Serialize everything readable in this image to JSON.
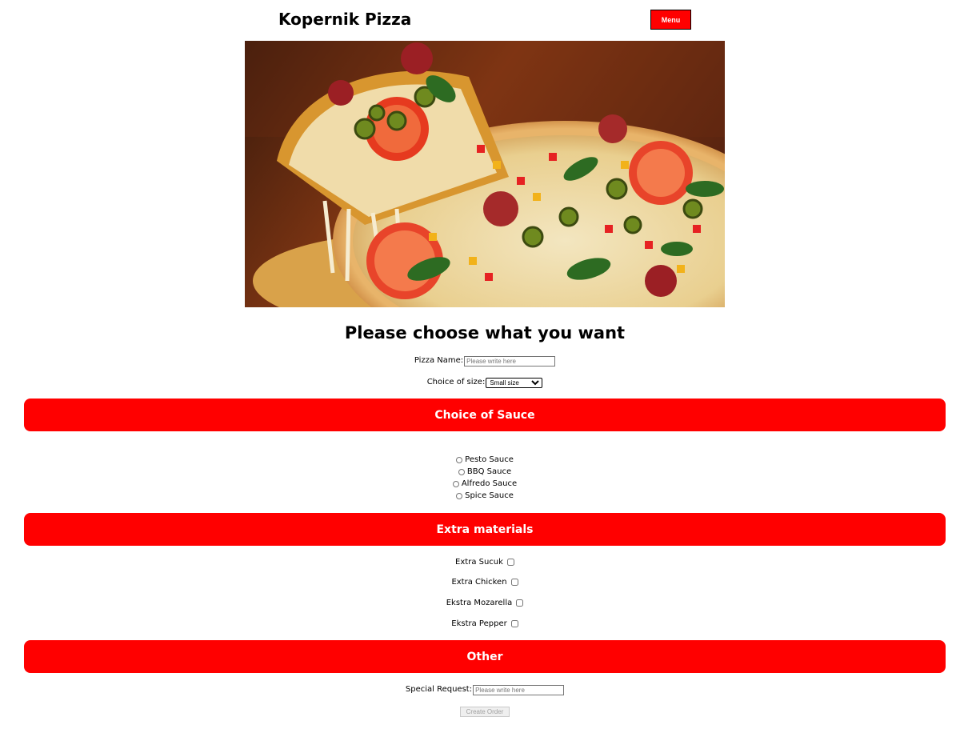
{
  "header": {
    "site_title": "Kopernik Pizza",
    "menu_label": "Menu"
  },
  "hero": {
    "alt": "pizza-photo"
  },
  "main": {
    "heading": "Please choose what you want",
    "pizza_name": {
      "label": "Pizza Name:",
      "placeholder": "Please write here"
    },
    "size": {
      "label": "Choice of size:",
      "selected": "Small size"
    }
  },
  "sauce": {
    "title": "Choice of Sauce",
    "options": [
      "Pesto Sauce",
      "BBQ Sauce",
      "Alfredo Sauce",
      "Spice Sauce"
    ]
  },
  "extras": {
    "title": "Extra materials",
    "options": [
      "Extra Sucuk",
      "Extra Chicken",
      "Ekstra Mozarella",
      "Ekstra Pepper"
    ]
  },
  "other": {
    "title": "Other",
    "special_request": {
      "label": "Special Request:",
      "placeholder": "Please write here"
    },
    "submit_label": "Create Order"
  },
  "colors": {
    "accent": "#ff0000",
    "accent_text": "#ffffff"
  }
}
